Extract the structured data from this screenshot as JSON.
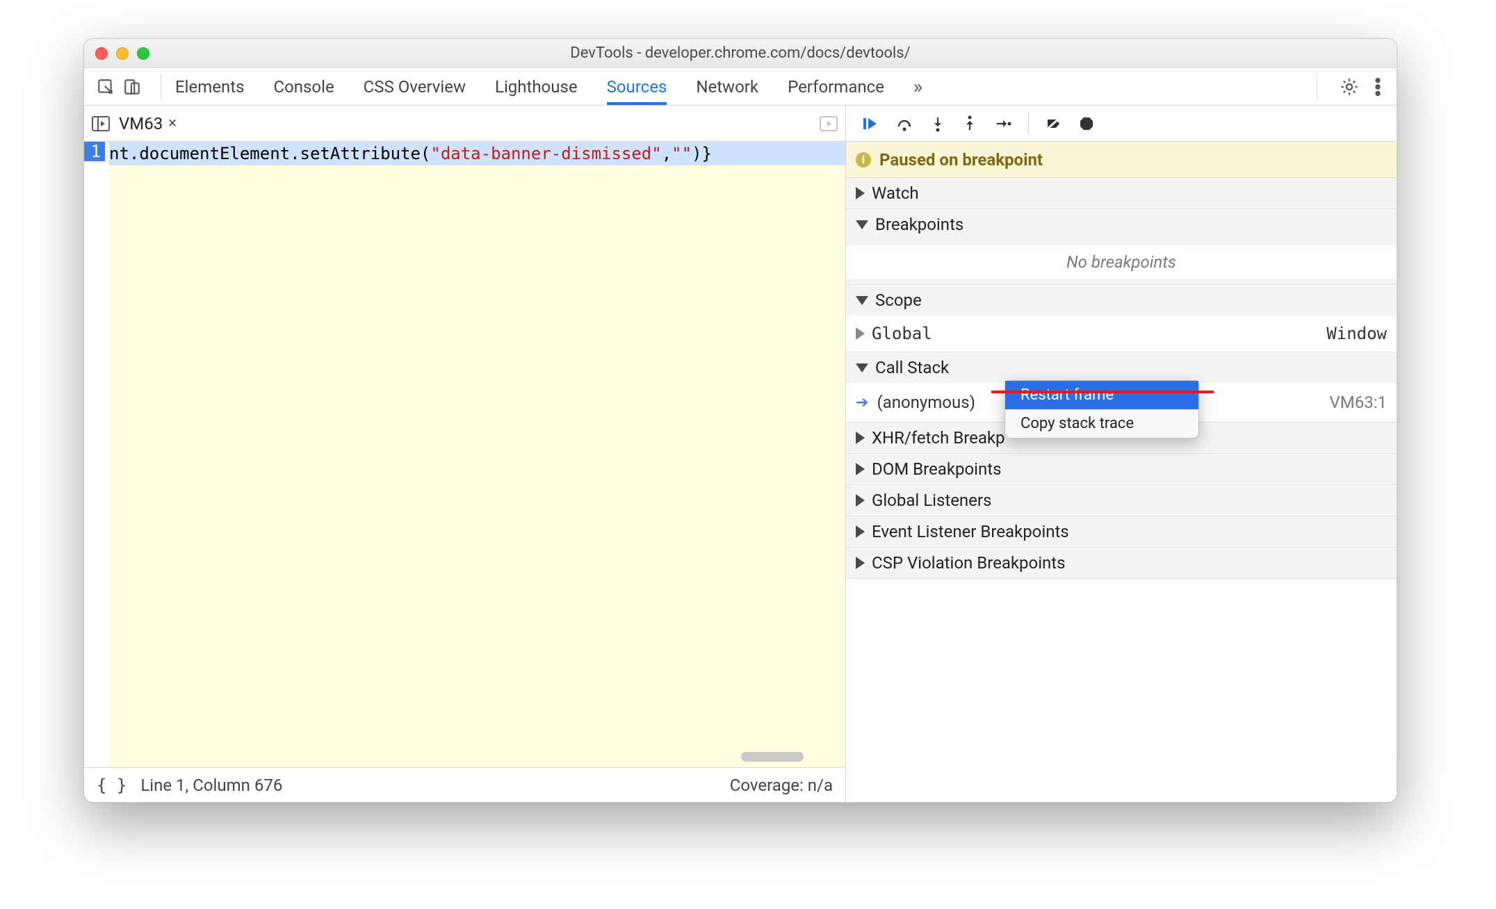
{
  "window": {
    "title": "DevTools - developer.chrome.com/docs/devtools/"
  },
  "tabs": [
    "Elements",
    "Console",
    "CSS Overview",
    "Lighthouse",
    "Sources",
    "Network",
    "Performance"
  ],
  "active_tab": "Sources",
  "editor": {
    "filetab": "VM63",
    "line_number": "1",
    "code_prefix": "nt.documentElement.setAttribute(",
    "code_string": "\"data-banner-dismissed\"",
    "code_mid": ",",
    "code_string2": "\"\"",
    "code_suffix": ")}"
  },
  "statusbar": {
    "cursor": "Line 1, Column 676",
    "coverage": "Coverage: n/a",
    "braces": "{ }"
  },
  "debugger": {
    "paused_label": "Paused on breakpoint",
    "sections": {
      "watch": "Watch",
      "breakpoints": "Breakpoints",
      "no_breakpoints": "No breakpoints",
      "scope": "Scope",
      "scope_global": "Global",
      "scope_global_value": "Window",
      "callstack": "Call Stack",
      "callstack_item": "(anonymous)",
      "callstack_source": "VM63:1",
      "xhr": "XHR/fetch Breakp",
      "dom": "DOM Breakpoints",
      "global_listeners": "Global Listeners",
      "event_listeners": "Event Listener Breakpoints",
      "csp": "CSP Violation Breakpoints"
    }
  },
  "context_menu": {
    "restart": "Restart frame",
    "copy": "Copy stack trace"
  }
}
